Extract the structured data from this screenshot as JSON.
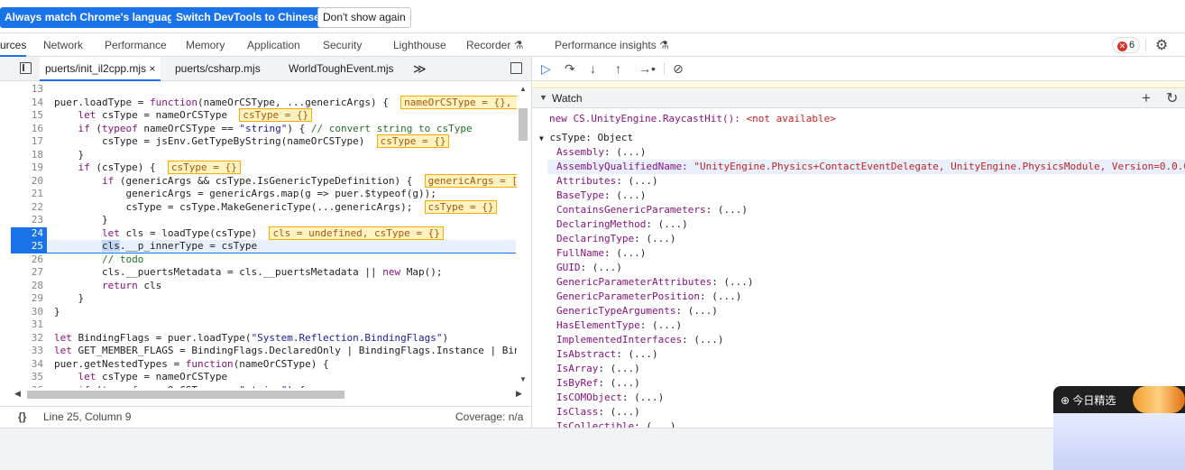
{
  "infobar": {
    "always_match_label": "Always match Chrome's language",
    "switch_label": "Switch DevTools to Chinese",
    "dont_show_label": "Don't show again"
  },
  "tabs": [
    {
      "label": "urces"
    },
    {
      "label": "Network"
    },
    {
      "label": "Performance"
    },
    {
      "label": "Memory"
    },
    {
      "label": "Application"
    },
    {
      "label": "Security"
    },
    {
      "label": "Lighthouse"
    },
    {
      "label": "Recorder"
    },
    {
      "label": "Performance insights"
    }
  ],
  "error_count": "6",
  "editor_tabs": [
    {
      "label": "puerts/init_il2cpp.mjs ×"
    },
    {
      "label": "puerts/csharp.mjs"
    },
    {
      "label": "WorldToughEvent.mjs"
    },
    {
      "label": "≫"
    }
  ],
  "status_bar": {
    "braces": "{}",
    "position": "Line 25, Column 9",
    "coverage": "Coverage: n/a"
  },
  "watch": {
    "title": "Watch",
    "raycast_expr": "new CS.UnityEngine.RaycastHit(): ",
    "raycast_val": "<not available>",
    "cstype_name": "csType: ",
    "cstype_val": "Object",
    "aqn_key": "AssemblyQualifiedName: ",
    "aqn_val": "\"UnityEngine.Physics+ContactEventDelegate, UnityEngine.PhysicsModule, Version=0.0.0.0",
    "props": [
      "Assembly",
      "Attributes",
      "BaseType",
      "ContainsGenericParameters",
      "DeclaringMethod",
      "DeclaringType",
      "FullName",
      "GUID",
      "GenericParameterAttributes",
      "GenericParameterPosition",
      "GenericTypeArguments",
      "HasElementType",
      "ImplementedInterfaces",
      "IsAbstract",
      "IsArray",
      "IsByRef",
      "IsCOMObject",
      "IsClass",
      "IsCollectible"
    ],
    "collapsed_val": "(...)"
  },
  "popup": {
    "title": "今日精选"
  },
  "colors": {
    "accent": "#1a73e8",
    "error": "#d93025",
    "keyword": "#881280"
  }
}
